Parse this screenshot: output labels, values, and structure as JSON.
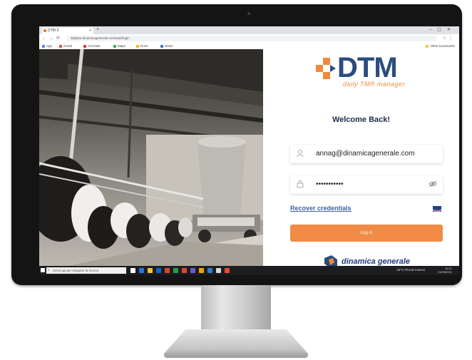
{
  "browser": {
    "tab_title": "DTM X",
    "url": "dailytmr.dinamicagenerale.com/auth/login",
    "bookmarks": [
      "App",
      "Gmail",
      "YouTube",
      "Maps",
      "Drive",
      "News",
      "Other bookmarks"
    ]
  },
  "login": {
    "brand": "DTM",
    "tagline": "daily TMR manager",
    "welcome": "Welcome Back!",
    "email_value": "annag@dinamicagenerale.com",
    "password_value": "•••••••••••",
    "recover_label": "Recover credentials",
    "login_label": "Log in",
    "company": "dinamica generale",
    "language_flag": "UK"
  },
  "taskbar": {
    "search_placeholder": "Scrivi qui per eseguire la ricerca",
    "weather": "23°C  Piccoli rovesci",
    "time": "10:21",
    "date": "21/09/2021"
  },
  "colors": {
    "accent": "#f28b45",
    "brand_blue": "#2b4c7e",
    "link": "#3b63a8"
  },
  "icons": [
    "user-icon",
    "lock-icon",
    "eye-slash-icon",
    "uk-flag-icon",
    "windows-start-icon",
    "search-icon"
  ]
}
